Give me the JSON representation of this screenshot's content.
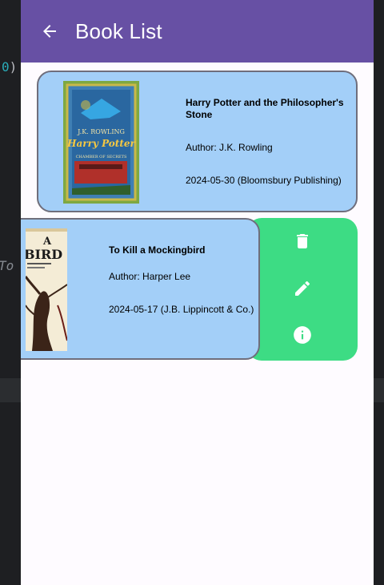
{
  "ide": {
    "paren_num": "0",
    "paren_close": ")",
    "fragment": "To"
  },
  "appbar": {
    "title": "Book List",
    "back_icon": "arrow-back-icon"
  },
  "books": [
    {
      "title": "Harry Potter and the Philosopher's Stone",
      "author": "Author: J.K. Rowling",
      "date": "2024-05-30 (Bloomsbury Publishing)",
      "cover": {
        "author_text": "J.K. ROWLING",
        "title_text": "Harry Potter",
        "subtitle_text": "CHAMBER OF SECRETS"
      }
    },
    {
      "title": "To Kill a Mockingbird",
      "author": "Author: Harper Lee",
      "date": "2024-05-17 (J.B. Lippincott & Co.)",
      "cover": {
        "title_text": "BIRD",
        "top_text": "A"
      }
    }
  ],
  "actions": [
    {
      "icon": "delete-icon"
    },
    {
      "icon": "edit-icon"
    },
    {
      "icon": "info-icon"
    }
  ],
  "colors": {
    "appbar": "#6750a4",
    "card": "#a3cff8",
    "actions_bg": "#3ddc84",
    "background": "#fefbff"
  }
}
